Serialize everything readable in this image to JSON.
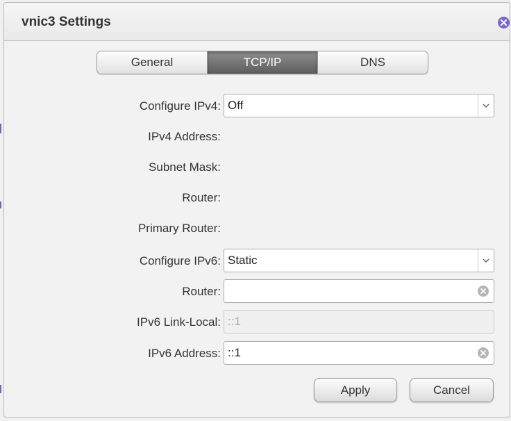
{
  "dialog": {
    "title": "vnic3 Settings",
    "close_icon": "close-icon",
    "accent_color": "#7b68c9"
  },
  "tabs": [
    {
      "label": "General",
      "active": false
    },
    {
      "label": "TCP/IP",
      "active": true
    },
    {
      "label": "DNS",
      "active": false
    }
  ],
  "form": {
    "configure_ipv4": {
      "label": "Configure IPv4:",
      "value": "Off"
    },
    "ipv4_address": {
      "label": "IPv4 Address:"
    },
    "subnet_mask": {
      "label": "Subnet Mask:"
    },
    "router_v4": {
      "label": "Router:"
    },
    "primary_router": {
      "label": "Primary Router:"
    },
    "configure_ipv6": {
      "label": "Configure IPv6:",
      "value": "Static"
    },
    "router_v6": {
      "label": "Router:",
      "value": ""
    },
    "ipv6_link_local": {
      "label": "IPv6 Link-Local:",
      "value": "::1"
    },
    "ipv6_address": {
      "label": "IPv6 Address:",
      "value": "::1"
    }
  },
  "buttons": {
    "apply": "Apply",
    "cancel": "Cancel"
  }
}
